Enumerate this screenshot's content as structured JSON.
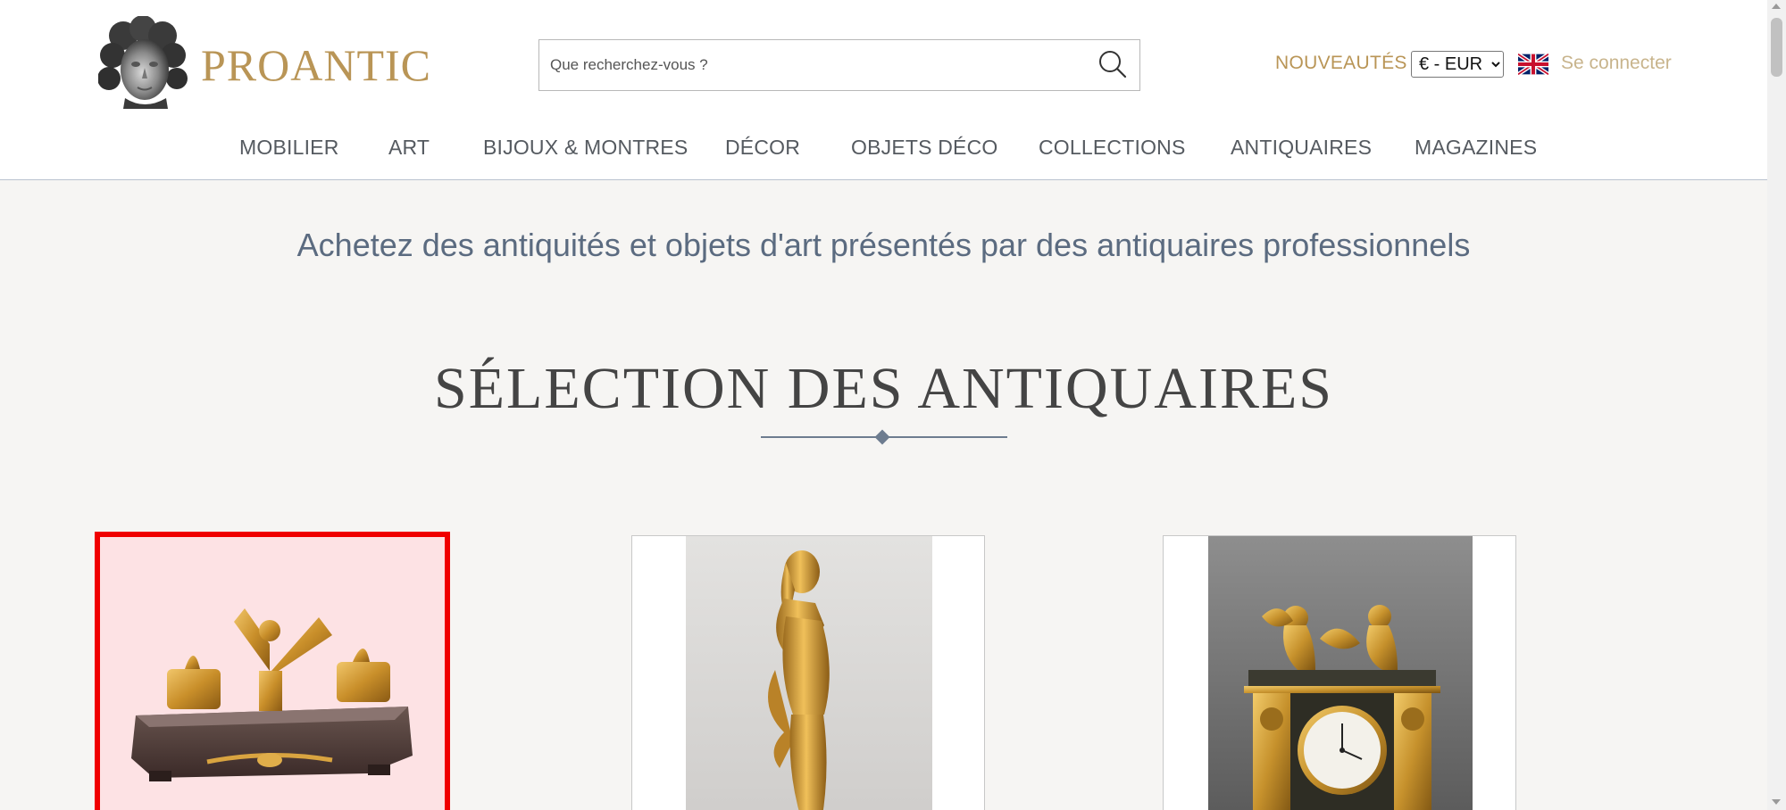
{
  "header": {
    "brand": "PROANTIC",
    "logo_icon": "statue-head-logo",
    "search": {
      "placeholder": "Que recherchez-vous ?",
      "value": "",
      "icon": "search-icon"
    },
    "nouveautes_label": "NOUVEAUTÉS",
    "currency": {
      "selected": "€ - EUR",
      "options": [
        "€ - EUR"
      ]
    },
    "language_icon": "uk-flag-icon",
    "login_label": "Se connecter",
    "colors": {
      "brand": "#b99556",
      "login": "#c8b48c"
    }
  },
  "nav": {
    "items": [
      {
        "label": "MOBILIER"
      },
      {
        "label": "ART"
      },
      {
        "label": "BIJOUX & MONTRES"
      },
      {
        "label": "DÉCOR"
      },
      {
        "label": "OBJETS DÉCO"
      },
      {
        "label": "COLLECTIONS"
      },
      {
        "label": "ANTIQUAIRES"
      },
      {
        "label": "MAGAZINES"
      }
    ]
  },
  "main": {
    "tagline": "Achetez des antiquités et objets d'art présentés par des antiquaires professionnels",
    "section_title": "SÉLECTION DES ANTIQUAIRES",
    "products": [
      {
        "image": "gilt-bronze-eagle-inkwell",
        "selected": true
      },
      {
        "image": "gilt-bronze-female-statue",
        "selected": false
      },
      {
        "image": "gilt-bronze-mantel-clock",
        "selected": false
      }
    ],
    "colors": {
      "selection_outline": "#f00000",
      "selection_fill": "#fde2e4"
    }
  }
}
